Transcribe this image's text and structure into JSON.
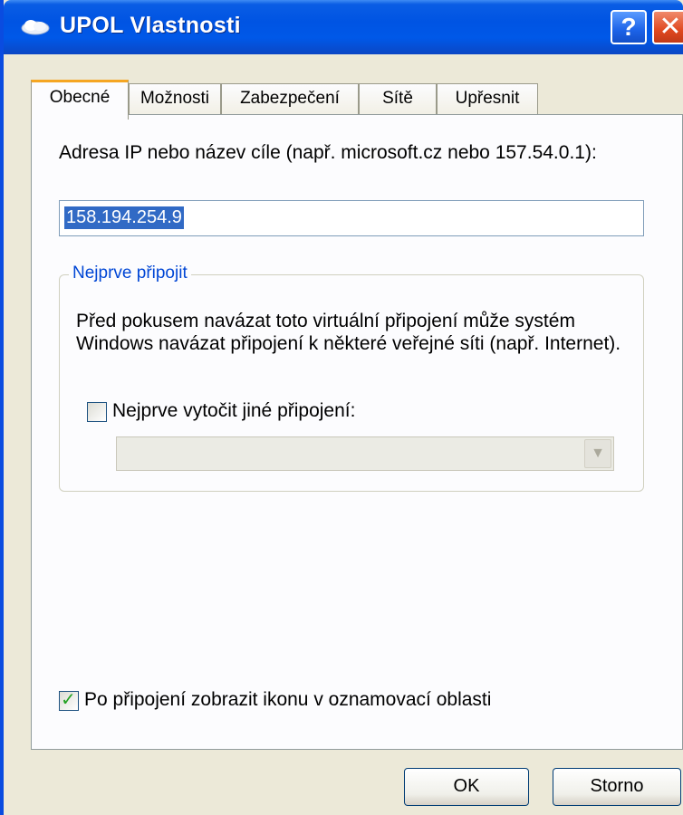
{
  "window": {
    "title": "UPOL Vlastnosti",
    "help_label": "?",
    "close_label": "✕",
    "icon": "network-connection-icon"
  },
  "tabs": [
    {
      "label": "Obecné",
      "active": true
    },
    {
      "label": "Možnosti",
      "active": false
    },
    {
      "label": "Zabezpečení",
      "active": false
    },
    {
      "label": "Sítě",
      "active": false
    },
    {
      "label": "Upřesnit",
      "active": false
    }
  ],
  "general": {
    "ip_label": "Adresa IP nebo název cíle (např. microsoft.cz nebo 157.54.0.1):",
    "ip_value": "158.194.254.9",
    "first_connect": {
      "title": "Nejprve připojit",
      "description": "Před pokusem navázat toto virtuální připojení může systém Windows navázat připojení k některé veřejné síti (např. Internet).",
      "dial_label": "Nejprve vytočit jiné připojení:",
      "dial_checked": false,
      "combo_value": "",
      "combo_enabled": false
    },
    "notify_label": "Po připojení zobrazit ikonu v oznamovací oblasti",
    "notify_checked": true
  },
  "footer": {
    "ok_label": "OK",
    "cancel_label": "Storno"
  },
  "colors": {
    "titlebar": "#0054e3",
    "face": "#ece9d8",
    "selection": "#316ac5",
    "group_title": "#0046d5",
    "active_tab_accent": "#f5a623"
  }
}
